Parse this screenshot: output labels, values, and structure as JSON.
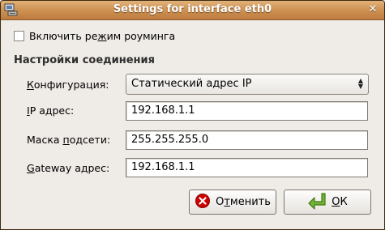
{
  "window": {
    "title": "Settings for interface eth0",
    "close_glyph": "✕"
  },
  "roaming": {
    "label_pre": "Включить ре",
    "label_mnemonic": "ж",
    "label_post": "им роуминга",
    "checked": false
  },
  "connection": {
    "section_title": "Настройки соединения",
    "config": {
      "label_mnemonic": "К",
      "label_post": "онфигурация:",
      "value": "Статический адрес IP"
    },
    "ip": {
      "label_mnemonic": "I",
      "label_post": "P адрес:",
      "value": "192.168.1.1"
    },
    "netmask": {
      "label_pre": "Маска ",
      "label_mnemonic": "п",
      "label_post": "одсети:",
      "value": "255.255.255.0"
    },
    "gateway": {
      "label_mnemonic": "G",
      "label_post": "ateway адрес:",
      "value": "192.168.1.1"
    }
  },
  "buttons": {
    "cancel": {
      "pre": "О",
      "mnemonic": "т",
      "post": "менить",
      "icon": "cancel-icon",
      "icon_color": "#cc0000"
    },
    "ok": {
      "mnemonic": "О",
      "post": "К",
      "icon": "enter-arrow-icon",
      "icon_color": "#4e9a06"
    }
  }
}
